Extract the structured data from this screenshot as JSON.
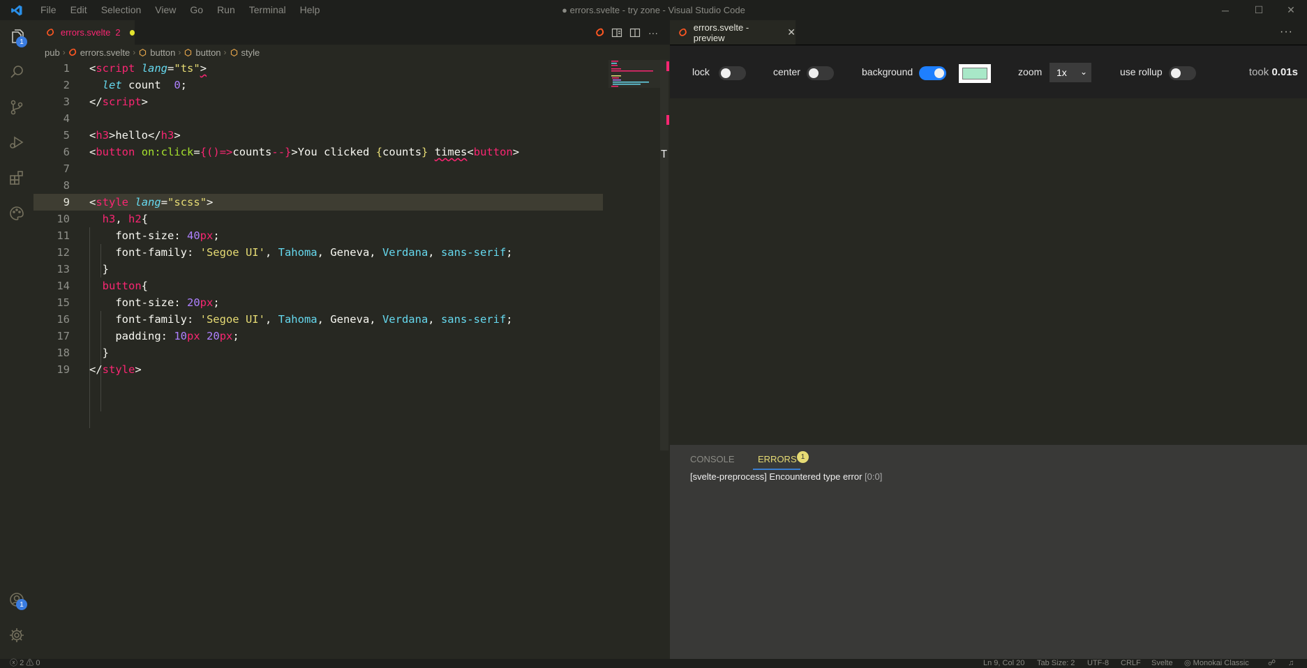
{
  "window": {
    "title": "● errors.svelte - try zone - Visual Studio Code",
    "menu": [
      "File",
      "Edit",
      "Selection",
      "View",
      "Go",
      "Run",
      "Terminal",
      "Help"
    ]
  },
  "activity": {
    "explorer_badge": "1",
    "accounts_badge": "1"
  },
  "editor": {
    "tab": {
      "name": "errors.svelte",
      "problems": "2"
    },
    "breadcrumb": [
      "pub",
      "errors.svelte",
      "button",
      "button",
      "style"
    ],
    "lines": [
      {
        "n": "1",
        "seg": [
          [
            "&lt;",
            "#f8f8f2"
          ],
          [
            "script",
            "#f92672"
          ],
          [
            " ",
            ""
          ],
          [
            "lang",
            "#66d9ef",
            "i"
          ],
          [
            "=",
            ""
          ],
          [
            "\"ts\"",
            "#e6db74"
          ],
          [
            "&gt;",
            "#f8f8f2",
            "w"
          ]
        ]
      },
      {
        "n": "2",
        "seg": [
          [
            "  ",
            ""
          ],
          [
            "let",
            "#66d9ef",
            "i"
          ],
          [
            " count  ",
            ""
          ],
          [
            "0",
            "#ae81ff"
          ],
          [
            ";",
            ""
          ]
        ]
      },
      {
        "n": "3",
        "seg": [
          [
            "&lt;/",
            "#f8f8f2"
          ],
          [
            "script",
            "#f92672"
          ],
          [
            "&gt;",
            ""
          ]
        ]
      },
      {
        "n": "4",
        "seg": []
      },
      {
        "n": "5",
        "seg": [
          [
            "&lt;",
            ""
          ],
          [
            "h3",
            "#f92672"
          ],
          [
            "&gt;hello&lt;/",
            ""
          ],
          [
            "h3",
            "#f92672"
          ],
          [
            "&gt;",
            ""
          ]
        ]
      },
      {
        "n": "6",
        "seg": [
          [
            "&lt;",
            ""
          ],
          [
            "button",
            "#f92672"
          ],
          [
            " ",
            ""
          ],
          [
            "on:click",
            "#a6e22e"
          ],
          [
            "=",
            ""
          ],
          [
            "{",
            "#f92672"
          ],
          [
            "()=&gt;",
            "#f92672"
          ],
          [
            "counts",
            "#f8f8f2"
          ],
          [
            "--",
            "#f92672"
          ],
          [
            "}",
            "#f92672"
          ],
          [
            "&gt;You clicked ",
            ""
          ],
          [
            "{",
            "#e6db74"
          ],
          [
            "counts",
            "#f8f8f2"
          ],
          [
            "}",
            "#e6db74"
          ],
          [
            " ",
            ""
          ],
          [
            "times",
            "#f8f8f2",
            "w"
          ],
          [
            "&lt;",
            ""
          ],
          [
            "button",
            "#f92672"
          ],
          [
            "&gt;",
            ""
          ]
        ]
      },
      {
        "n": "7",
        "seg": []
      },
      {
        "n": "8",
        "seg": []
      },
      {
        "n": "9",
        "seg": [
          [
            "&lt;",
            ""
          ],
          [
            "style",
            "#f92672"
          ],
          [
            " ",
            ""
          ],
          [
            "lang",
            "#66d9ef",
            "i"
          ],
          [
            "=",
            ""
          ],
          [
            "\"scss\"",
            "#e6db74"
          ],
          [
            "&gt;",
            ""
          ]
        ],
        "current": true
      },
      {
        "n": "10",
        "seg": [
          [
            "  ",
            ""
          ],
          [
            "h3",
            "#f92672"
          ],
          [
            ", ",
            ""
          ],
          [
            "h2",
            "#f92672"
          ],
          [
            "{",
            ""
          ]
        ]
      },
      {
        "n": "11",
        "seg": [
          [
            "    font-size: ",
            ""
          ],
          [
            "40",
            "#ae81ff"
          ],
          [
            "px",
            "#f92672"
          ],
          [
            ";",
            ""
          ]
        ]
      },
      {
        "n": "12",
        "seg": [
          [
            "    font-family: ",
            ""
          ],
          [
            "'Segoe UI'",
            "#e6db74"
          ],
          [
            ", ",
            ""
          ],
          [
            "Tahoma",
            "#66d9ef"
          ],
          [
            ", Geneva, ",
            ""
          ],
          [
            "Verdana",
            "#66d9ef"
          ],
          [
            ", ",
            ""
          ],
          [
            "sans-serif",
            "#66d9ef"
          ],
          [
            ";",
            ""
          ]
        ]
      },
      {
        "n": "13",
        "seg": [
          [
            "  }",
            ""
          ]
        ]
      },
      {
        "n": "14",
        "seg": [
          [
            "  ",
            ""
          ],
          [
            "button",
            "#f92672"
          ],
          [
            "{",
            ""
          ]
        ]
      },
      {
        "n": "15",
        "seg": [
          [
            "    font-size: ",
            ""
          ],
          [
            "20",
            "#ae81ff"
          ],
          [
            "px",
            "#f92672"
          ],
          [
            ";",
            ""
          ]
        ]
      },
      {
        "n": "16",
        "seg": [
          [
            "    font-family: ",
            ""
          ],
          [
            "'Segoe UI'",
            "#e6db74"
          ],
          [
            ", ",
            ""
          ],
          [
            "Tahoma",
            "#66d9ef"
          ],
          [
            ", Geneva, ",
            ""
          ],
          [
            "Verdana",
            "#66d9ef"
          ],
          [
            ", ",
            ""
          ],
          [
            "sans-serif",
            "#66d9ef"
          ],
          [
            ";",
            ""
          ]
        ]
      },
      {
        "n": "17",
        "seg": [
          [
            "    padding: ",
            ""
          ],
          [
            "10",
            "#ae81ff"
          ],
          [
            "px",
            "#f92672"
          ],
          [
            " ",
            ""
          ],
          [
            "20",
            "#ae81ff"
          ],
          [
            "px",
            "#f92672"
          ],
          [
            ";",
            ""
          ]
        ]
      },
      {
        "n": "18",
        "seg": [
          [
            "  }",
            ""
          ]
        ]
      },
      {
        "n": "19",
        "seg": [
          [
            "&lt;/",
            ""
          ],
          [
            "style",
            "#f92672"
          ],
          [
            "&gt;",
            ""
          ]
        ]
      }
    ]
  },
  "preview": {
    "tab_title": "errors.svelte - preview",
    "lock_label": "lock",
    "center_label": "center",
    "background_label": "background",
    "zoom_label": "zoom",
    "zoom_value": "1x",
    "rollup_label": "use rollup",
    "took_prefix": "took",
    "took_value": "0.01s",
    "toggles": {
      "lock": false,
      "center": false,
      "background": true,
      "rollup": false
    },
    "background_color": "#a8e8c8",
    "panel_tabs": {
      "console": "CONSOLE",
      "errors": "ERRORS",
      "errors_count": "1"
    },
    "error_message": "[svelte-preprocess] Encountered type error",
    "error_location": "[0:0]"
  },
  "status": {
    "errors": "2",
    "warnings": "0",
    "position": "Ln 9, Col 20",
    "tab_size": "Tab Size: 2",
    "encoding": "UTF-8",
    "eol": "CRLF",
    "language": "Svelte",
    "theme": "Monokai Classic"
  },
  "colors": {
    "accent": "#f92672",
    "string": "#e6db74",
    "keyword": "#66d9ef",
    "number": "#ae81ff",
    "function": "#a6e22e"
  }
}
